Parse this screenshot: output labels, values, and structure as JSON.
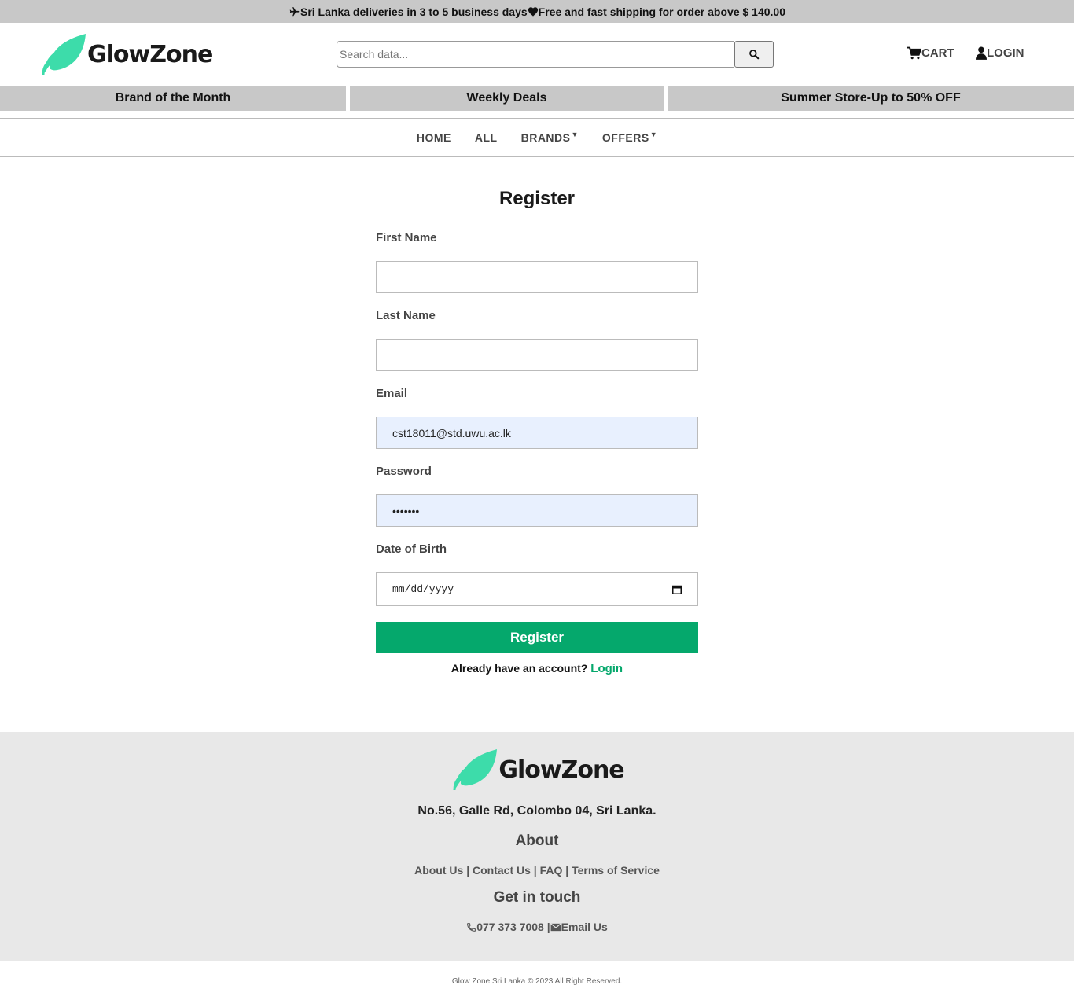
{
  "announcement": {
    "part1": "Sri Lanka deliveries in 3 to 5 business days",
    "part2": "Free and fast shipping for order above $ 140.00"
  },
  "header": {
    "logo_text": "GlowZone",
    "search_placeholder": "Search data...",
    "cart_label": "CART",
    "login_label": "LOGIN"
  },
  "promos": [
    "Brand of the Month",
    "Weekly Deals",
    "Summer Store-Up to 50% OFF"
  ],
  "nav": {
    "home": "HOME",
    "all": "ALL",
    "brands": "BRANDS",
    "offers": "OFFERS"
  },
  "form": {
    "title": "Register",
    "first_name_label": "First Name",
    "first_name_value": "",
    "last_name_label": "Last Name",
    "last_name_value": "",
    "email_label": "Email",
    "email_value": "cst18011@std.uwu.ac.lk",
    "password_label": "Password",
    "password_value": "•••••••",
    "dob_label": "Date of Birth",
    "dob_placeholder": "mm/dd/yyyy",
    "submit_label": "Register",
    "already_text": "Already have an account?",
    "login_link": "Login"
  },
  "footer": {
    "logo_text": "GlowZone",
    "address": "No.56, Galle Rd, Colombo 04, Sri Lanka.",
    "about_heading": "About",
    "links": [
      "About Us",
      "Contact Us",
      "FAQ",
      "Terms of Service"
    ],
    "touch_heading": "Get in touch",
    "phone": "077 373 7008",
    "email_link": "Email Us",
    "copyright": "Glow Zone Sri Lanka © 2023 All Right Reserved."
  },
  "colors": {
    "accent": "#05a86c",
    "logo_leaf": "#3ddcaa",
    "bar_gray": "#c8c8c8",
    "autofill": "#e8f0fe"
  }
}
